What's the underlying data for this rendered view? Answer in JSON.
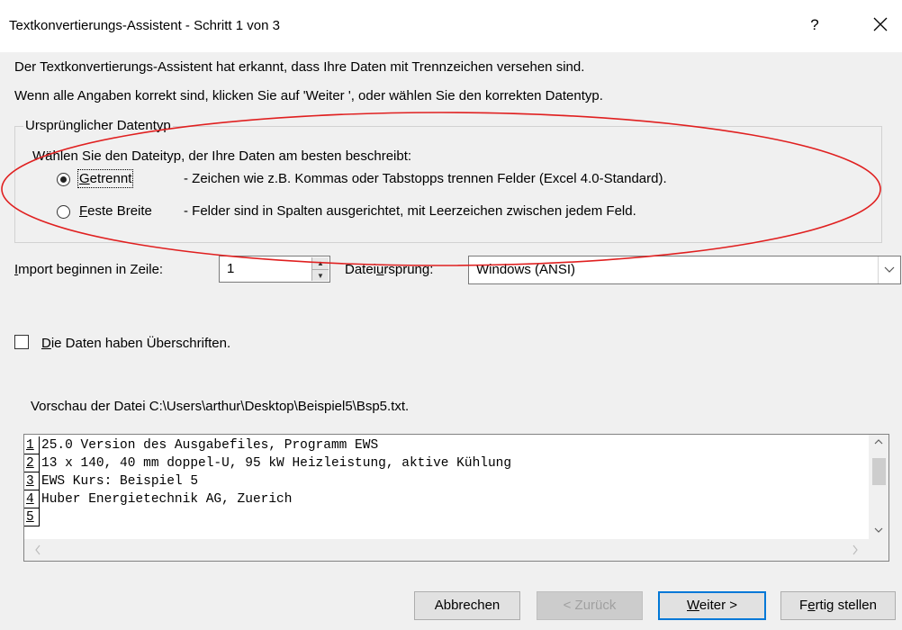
{
  "window": {
    "title": "Textkonvertierungs-Assistent - Schritt 1 von 3",
    "help_label": "?",
    "close_icon": "close-icon"
  },
  "intro": {
    "line1": "Der Textkonvertierungs-Assistent hat erkannt, dass Ihre Daten mit Trennzeichen versehen sind.",
    "line2": "Wenn alle Angaben korrekt sind, klicken Sie auf 'Weiter ', oder wählen Sie den korrekten Datentyp."
  },
  "datatype_group": {
    "title": "Ursprünglicher Datentyp",
    "prompt": "Wählen Sie den Dateityp, der Ihre Daten am besten beschreibt:",
    "options": [
      {
        "hotkey": "G",
        "rest": "etrennt",
        "description": "- Zeichen wie z.B. Kommas oder Tabstopps trennen Felder (Excel 4.0-Standard).",
        "selected": true
      },
      {
        "hotkey": "F",
        "rest": "este Breite",
        "description": "- Felder sind in Spalten ausgerichtet, mit Leerzeichen zwischen jedem Feld.",
        "selected": false
      }
    ]
  },
  "import_row": {
    "start_label_hotkey": "I",
    "start_label_rest": "mport beginnen in Zeile:",
    "start_value": "1",
    "origin_label_pre": "Datei",
    "origin_label_hotkey": "u",
    "origin_label_post": "rsprung:",
    "origin_value": "Windows (ANSI)"
  },
  "headers_checkbox": {
    "hotkey": "D",
    "rest": "ie Daten haben Überschriften.",
    "checked": false
  },
  "preview": {
    "label": "Vorschau der Datei C:\\Users\\arthur\\Desktop\\Beispiel5\\Bsp5.txt.",
    "rows": [
      {
        "num": "1",
        "text": "25.0 Version des Ausgabefiles, Programm EWS"
      },
      {
        "num": "2",
        "text": "13 x 140, 40 mm doppel-U, 95 kW Heizleistung, aktive Kühlung"
      },
      {
        "num": "3",
        "text": "EWS Kurs: Beispiel 5"
      },
      {
        "num": "4",
        "text": "Huber Energietechnik AG, Zuerich"
      },
      {
        "num": "5",
        "text": ""
      }
    ]
  },
  "buttons": {
    "cancel": "Abbrechen",
    "back": "< Zurück",
    "next_hotkey": "W",
    "next_rest": "eiter >",
    "finish_pre": "F",
    "finish_hotkey": "e",
    "finish_post": "rtig stellen"
  },
  "colors": {
    "annotation_ellipse": "#e02020",
    "default_button_border": "#0078d7"
  }
}
